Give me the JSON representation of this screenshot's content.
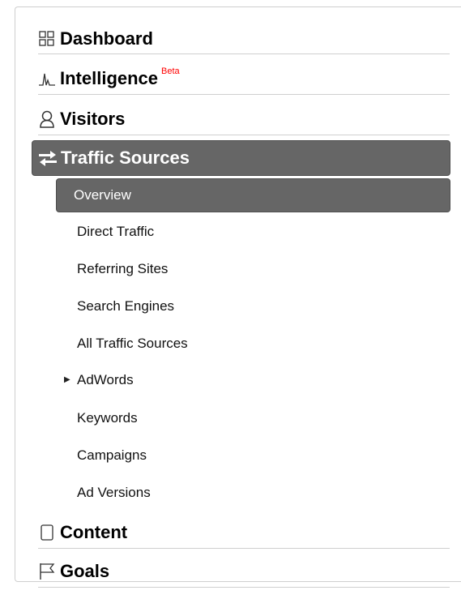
{
  "sections": {
    "dashboard": {
      "label": "Dashboard",
      "icon": "dashboard-grid-icon"
    },
    "intelligence": {
      "label": "Intelligence",
      "badge": "Beta",
      "icon": "intelligence-chart-icon"
    },
    "visitors": {
      "label": "Visitors",
      "icon": "visitors-person-icon"
    },
    "traffic_sources": {
      "label": "Traffic Sources",
      "icon": "traffic-sources-arrows-icon"
    },
    "content": {
      "label": "Content",
      "icon": "content-page-icon"
    },
    "goals": {
      "label": "Goals",
      "icon": "goals-flag-icon"
    }
  },
  "traffic_sources_items": [
    {
      "label": "Overview",
      "active": true
    },
    {
      "label": "Direct Traffic"
    },
    {
      "label": "Referring Sites"
    },
    {
      "label": "Search Engines"
    },
    {
      "label": "All Traffic Sources"
    },
    {
      "label": "AdWords",
      "expandable": true,
      "icon": "expand-triangle-icon"
    },
    {
      "label": "Keywords"
    },
    {
      "label": "Campaigns"
    },
    {
      "label": "Ad Versions"
    }
  ],
  "colors": {
    "active_bg": "#666666",
    "active_text": "#ffffff",
    "beta": "#ff0000",
    "divider": "#cfcfcf"
  }
}
